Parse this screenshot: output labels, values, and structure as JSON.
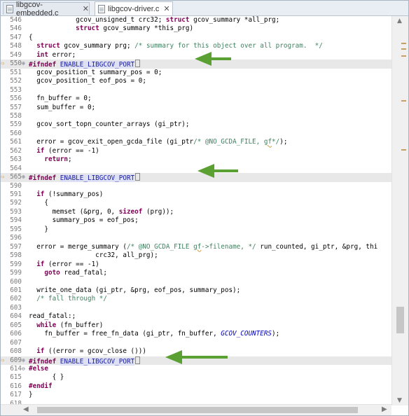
{
  "tabs": [
    {
      "label": "libgcov-embedded.c",
      "active": false,
      "close": "✕"
    },
    {
      "label": "libgcov-driver.c",
      "active": true,
      "close": "✕"
    }
  ],
  "gutter_marker": "⇨",
  "fold_collapsed": "⊕",
  "fold_expanded": "⊖",
  "scroll_arrows": {
    "up": "▲",
    "down": "▼",
    "left": "◀",
    "right": "▶"
  },
  "annotation_arrow_color": "#5aa032",
  "code_lines": [
    {
      "n": "546",
      "t": "            gcov_unsigned_t crc32; struct gcov_summary *all_prg;"
    },
    {
      "n": "546",
      "t": "            struct gcov_summary *this_prg)"
    },
    {
      "n": "547",
      "t": "{"
    },
    {
      "n": "548",
      "t": "  struct gcov_summary prg; /* summary for this object over all program.  */"
    },
    {
      "n": "549",
      "t": "  int error;"
    },
    {
      "n": "550",
      "t": "#ifndef ENABLE_LIBGCOV_PORT",
      "hl": true,
      "marker": true,
      "fold": "collapsed"
    },
    {
      "n": "551",
      "t": "  gcov_position_t summary_pos = 0;"
    },
    {
      "n": "552",
      "t": "  gcov_position_t eof_pos = 0;"
    },
    {
      "n": "553",
      "t": ""
    },
    {
      "n": "556",
      "t": "  fn_buffer = 0;"
    },
    {
      "n": "557",
      "t": "  sum_buffer = 0;"
    },
    {
      "n": "558",
      "t": ""
    },
    {
      "n": "559",
      "t": "  gcov_sort_topn_counter_arrays (gi_ptr);"
    },
    {
      "n": "560",
      "t": ""
    },
    {
      "n": "561",
      "t": "  error = gcov_exit_open_gcda_file (gi_ptr/* @NO_GCDA_FILE, gf*/);"
    },
    {
      "n": "562",
      "t": "  if (error == -1)"
    },
    {
      "n": "563",
      "t": "    return;"
    },
    {
      "n": "564",
      "t": ""
    },
    {
      "n": "565",
      "t": "#ifndef ENABLE_LIBGCOV_PORT",
      "hl": true,
      "marker": true,
      "fold": "collapsed"
    },
    {
      "n": "590",
      "t": ""
    },
    {
      "n": "591",
      "t": "  if (!summary_pos)"
    },
    {
      "n": "592",
      "t": "    {"
    },
    {
      "n": "593",
      "t": "      memset (&prg, 0, sizeof (prg));"
    },
    {
      "n": "594",
      "t": "      summary_pos = eof_pos;"
    },
    {
      "n": "595",
      "t": "    }"
    },
    {
      "n": "596",
      "t": ""
    },
    {
      "n": "597",
      "t": "  error = merge_summary (/* @NO_GCDA_FILE gf->filename, */ run_counted, gi_ptr, &prg, thi"
    },
    {
      "n": "598",
      "t": "                 crc32, all_prg);"
    },
    {
      "n": "599",
      "t": "  if (error == -1)"
    },
    {
      "n": "599",
      "t": "    goto read_fatal;"
    },
    {
      "n": "600",
      "t": ""
    },
    {
      "n": "601",
      "t": "  write_one_data (gi_ptr, &prg, eof_pos, summary_pos);"
    },
    {
      "n": "602",
      "t": "  /* fall through */"
    },
    {
      "n": "603",
      "t": ""
    },
    {
      "n": "604",
      "t": "read_fatal:;"
    },
    {
      "n": "605",
      "t": "  while (fn_buffer)"
    },
    {
      "n": "606",
      "t": "    fn_buffer = free_fn_data (gi_ptr, fn_buffer, GCOV_COUNTERS);"
    },
    {
      "n": "607",
      "t": ""
    },
    {
      "n": "608",
      "t": "  if ((error = gcov_close ()))"
    },
    {
      "n": "609",
      "t": "#ifndef ENABLE_LIBGCOV_PORT",
      "hl": true,
      "marker": true,
      "fold": "collapsed"
    },
    {
      "n": "614",
      "t": "#else",
      "fold": "expanded"
    },
    {
      "n": "615",
      "t": "      { }"
    },
    {
      "n": "616",
      "t": "#endif"
    },
    {
      "n": "617",
      "t": "}"
    },
    {
      "n": "618",
      "t": ""
    }
  ]
}
